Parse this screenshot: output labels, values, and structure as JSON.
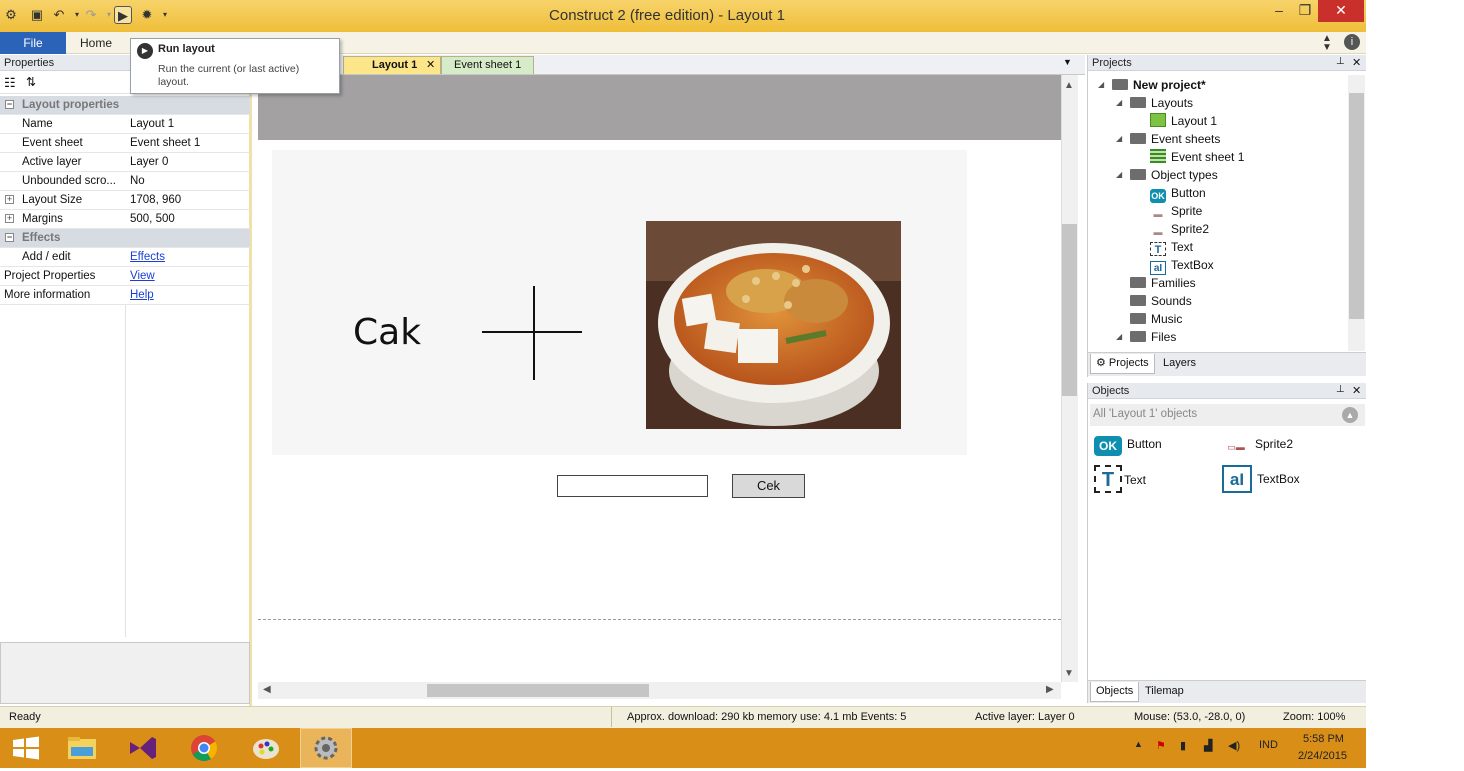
{
  "window": {
    "title": "Construct 2  (free edition) - Layout 1"
  },
  "ribbon": {
    "file_label": "File",
    "home_label": "Home"
  },
  "tooltip": {
    "title": "Run layout",
    "description": "Run the current (or last active) layout."
  },
  "properties": {
    "header": "Properties",
    "group_layout": "Layout properties",
    "rows": [
      {
        "key": "Name",
        "value": "Layout 1"
      },
      {
        "key": "Event sheet",
        "value": "Event sheet 1"
      },
      {
        "key": "Active layer",
        "value": "Layer 0"
      },
      {
        "key": "Unbounded scro...",
        "value": "No"
      },
      {
        "key": "Layout Size",
        "value": "1708, 960"
      },
      {
        "key": "Margins",
        "value": "500, 500"
      }
    ],
    "group_effects": "Effects",
    "effects_row": {
      "key": "Add / edit",
      "value": "Effects"
    },
    "project_row": {
      "key": "Project Properties",
      "value": "View"
    },
    "info_row": {
      "key": "More information",
      "value": "Help"
    }
  },
  "tabs": {
    "layout": "Layout 1",
    "event": "Event sheet 1"
  },
  "canvas": {
    "cak_text": "Cak",
    "button_label": "Cek"
  },
  "projects": {
    "header": "Projects",
    "root": "New project*",
    "layouts": "Layouts",
    "layout1": "Layout 1",
    "event_sheets": "Event sheets",
    "event_sheet1": "Event sheet 1",
    "object_types": "Object types",
    "types": [
      "Button",
      "Sprite",
      "Sprite2",
      "Text",
      "TextBox"
    ],
    "families": "Families",
    "sounds": "Sounds",
    "music": "Music",
    "files": "Files",
    "tab_projects": "Projects",
    "tab_layers": "Layers"
  },
  "objects": {
    "header": "Objects",
    "filter": "All 'Layout 1' objects",
    "items": [
      "Button",
      "Sprite2",
      "Text",
      "TextBox"
    ],
    "tab_objects": "Objects",
    "tab_tilemap": "Tilemap"
  },
  "status": {
    "ready": "Ready",
    "download": "Approx. download: 290 kb  memory use: 4.1 mb  Events: 5",
    "active_layer": "Active layer: Layer 0",
    "mouse": "Mouse: (53.0, -28.0, 0)",
    "zoom": "Zoom: 100%"
  },
  "taskbar": {
    "lang": "IND",
    "time": "5:58 PM",
    "date": "2/24/2015"
  },
  "colors": {
    "titlebar": "#efbe3a",
    "file_tab": "#2b63b8",
    "active_tab": "#fde68a",
    "taskbar": "#d98e18"
  }
}
